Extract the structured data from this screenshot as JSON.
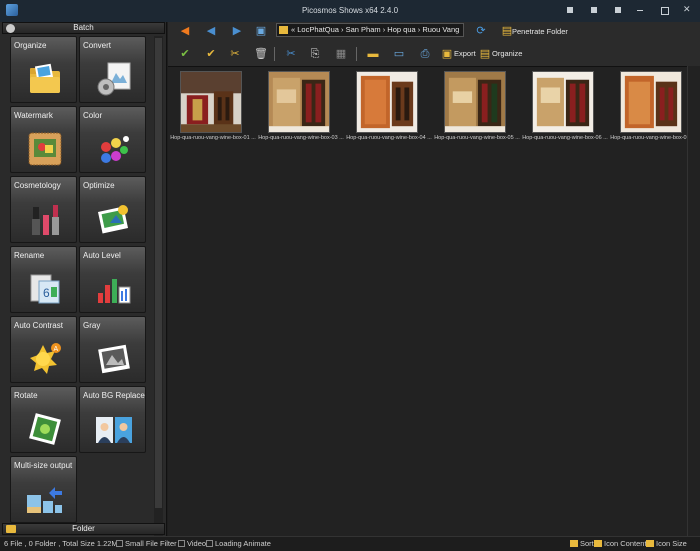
{
  "window": {
    "title": "Picosmos Shows x64 2.4.0"
  },
  "left_panel": {
    "header": "Batch",
    "footer": "Folder",
    "tools": [
      {
        "label": "Organize",
        "icon": "folder-photos-icon"
      },
      {
        "label": "Convert",
        "icon": "convert-icon"
      },
      {
        "label": "Watermark",
        "icon": "watermark-icon"
      },
      {
        "label": "Color",
        "icon": "color-balls-icon"
      },
      {
        "label": "Cosmetology",
        "icon": "cosmetics-icon"
      },
      {
        "label": "Optimize",
        "icon": "optimize-photo-icon"
      },
      {
        "label": "Rename",
        "icon": "rename-icon"
      },
      {
        "label": "Auto Level",
        "icon": "level-bars-icon"
      },
      {
        "label": "Auto Contrast",
        "icon": "contrast-sun-icon"
      },
      {
        "label": "Gray",
        "icon": "gray-photo-icon"
      },
      {
        "label": "Rotate",
        "icon": "rotate-photo-icon"
      },
      {
        "label": "Auto BG Replace",
        "icon": "bg-replace-icon"
      },
      {
        "label": "Multi-size output",
        "icon": "multisize-icon"
      }
    ]
  },
  "toolbar": {
    "path": "« LocPhatQua › San Pham › Hop qua › Ruou Vang",
    "penetrate_folder": "Penetrate Folder",
    "export": "Export",
    "organize": "Organize"
  },
  "files": [
    {
      "name": "Hop-qua-ruou-vang-wine-box-01 ..."
    },
    {
      "name": "Hop-qua-ruou-vang-wine-box-03 ..."
    },
    {
      "name": "Hop-qua-ruou-vang-wine-box-04 ..."
    },
    {
      "name": "Hop-qua-ruou-vang-wine-box-05 ..."
    },
    {
      "name": "Hop-qua-ruou-vang-wine-box-06 ..."
    },
    {
      "name": "Hop-qua-ruou-vang-wine-box-07 ..."
    }
  ],
  "status": {
    "summary": "6 File , 0 Folder , Total Size 1.22M",
    "small_file_filter": "Small File Filter",
    "video": "Video",
    "loading_animate": "Loading Animate",
    "sort": "Sort",
    "icon_content": "Icon Content",
    "icon_size": "Icon Size"
  },
  "colors": {
    "accent_orange": "#f07a1e",
    "check_green": "#7bc043",
    "folder_yellow": "#e8b93d"
  }
}
